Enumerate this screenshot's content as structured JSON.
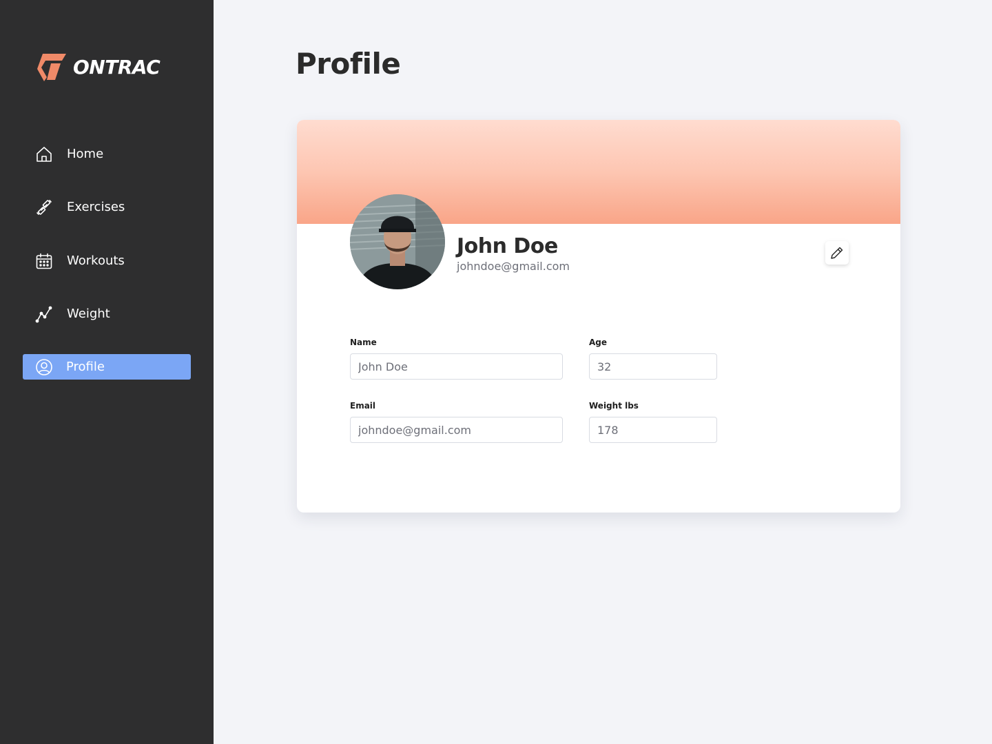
{
  "app": {
    "logo_text": "ONTRAC",
    "accent_color": "#f08a68",
    "active_nav_color": "#7ba6f5"
  },
  "sidebar": {
    "items": [
      {
        "label": "Home",
        "icon": "home-icon",
        "active": false
      },
      {
        "label": "Exercises",
        "icon": "dumbbell-icon",
        "active": false
      },
      {
        "label": "Workouts",
        "icon": "calendar-icon",
        "active": false
      },
      {
        "label": "Weight",
        "icon": "line-chart-icon",
        "active": false
      },
      {
        "label": "Profile",
        "icon": "user-circle-icon",
        "active": true
      }
    ]
  },
  "page": {
    "title": "Profile"
  },
  "profile": {
    "name": "John Doe",
    "email": "johndoe@gmail.com",
    "edit_icon": "pencil-icon"
  },
  "form": {
    "name": {
      "label": "Name",
      "value": "John Doe"
    },
    "age": {
      "label": "Age",
      "value": "32"
    },
    "email": {
      "label": "Email",
      "value": "johndoe@gmail.com"
    },
    "weight": {
      "label": "Weight lbs",
      "value": "178"
    }
  }
}
